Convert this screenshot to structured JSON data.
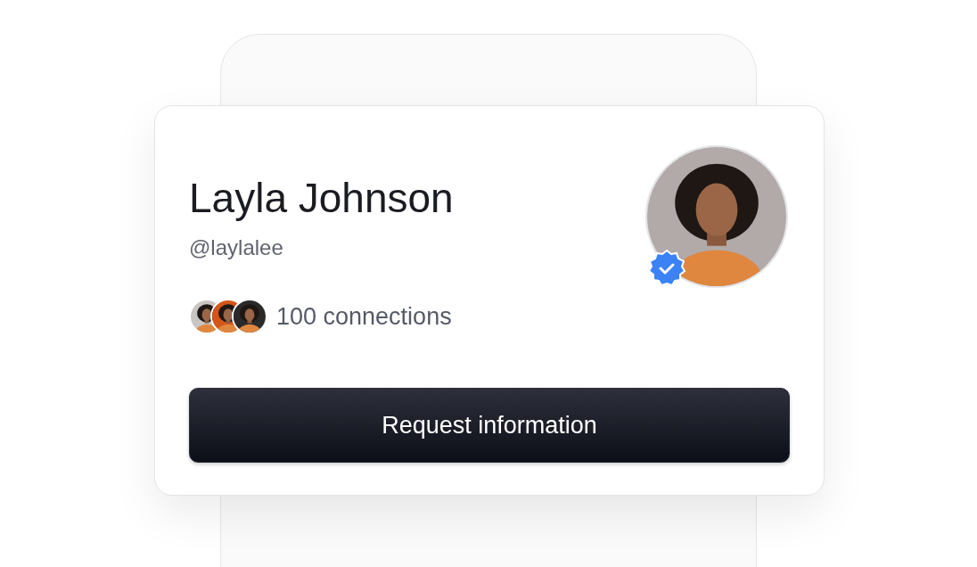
{
  "profile": {
    "name": "Layla Johnson",
    "handle": "@laylalee",
    "verified": true,
    "connections": "100 connections"
  },
  "button": {
    "label": "Request information"
  }
}
